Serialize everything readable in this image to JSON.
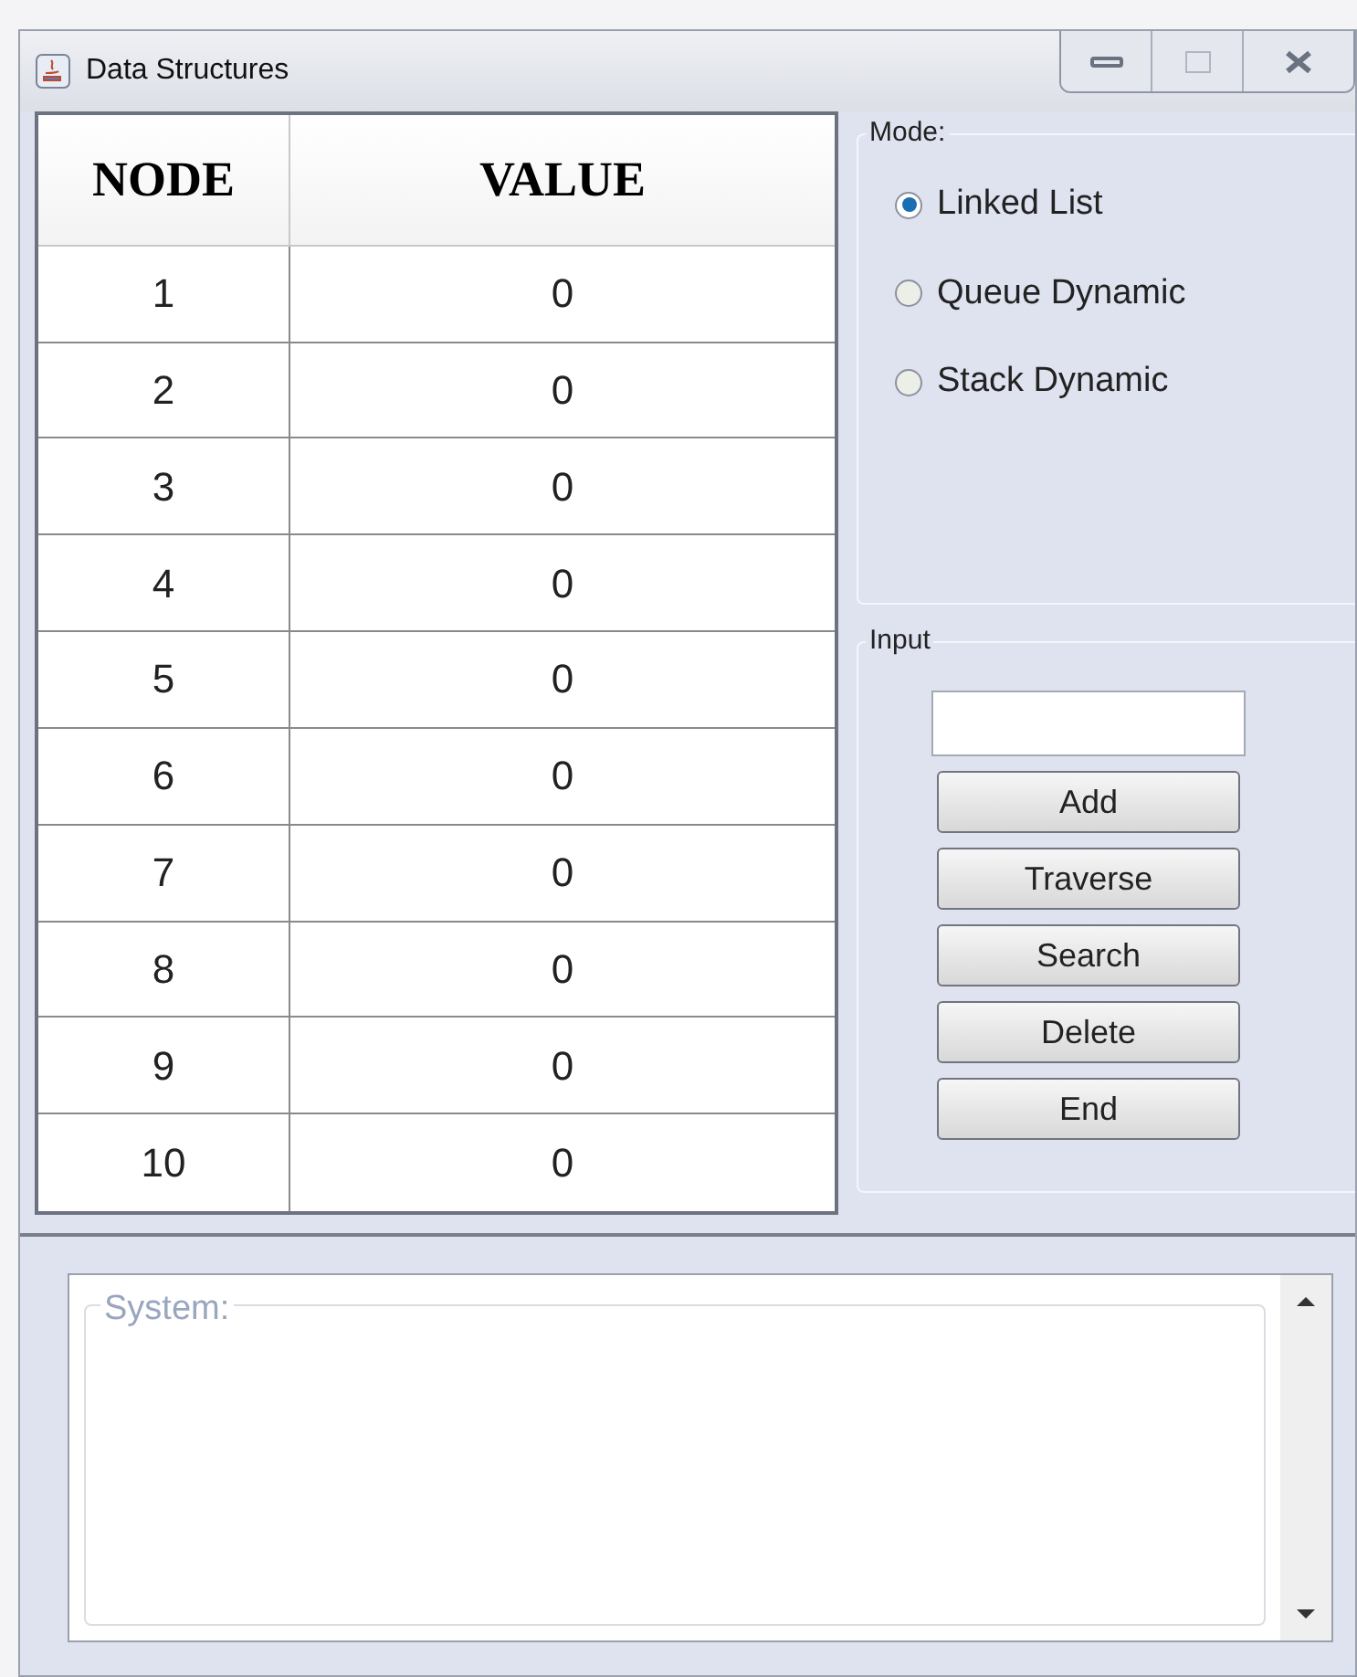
{
  "window": {
    "title": "Data Structures"
  },
  "table": {
    "columns": [
      "NODE",
      "VALUE"
    ],
    "rows": [
      [
        "1",
        "0"
      ],
      [
        "2",
        "0"
      ],
      [
        "3",
        "0"
      ],
      [
        "4",
        "0"
      ],
      [
        "5",
        "0"
      ],
      [
        "6",
        "0"
      ],
      [
        "7",
        "0"
      ],
      [
        "8",
        "0"
      ],
      [
        "9",
        "0"
      ],
      [
        "10",
        "0"
      ]
    ]
  },
  "mode": {
    "title": "Mode:",
    "options": [
      {
        "label": "Linked List",
        "selected": true
      },
      {
        "label": "Queue Dynamic",
        "selected": false
      },
      {
        "label": "Stack Dynamic",
        "selected": false
      }
    ]
  },
  "input": {
    "title": "Input",
    "buttons": [
      "Add",
      "Traverse",
      "Search",
      "Delete",
      "End"
    ]
  },
  "system": {
    "title": "System:"
  }
}
